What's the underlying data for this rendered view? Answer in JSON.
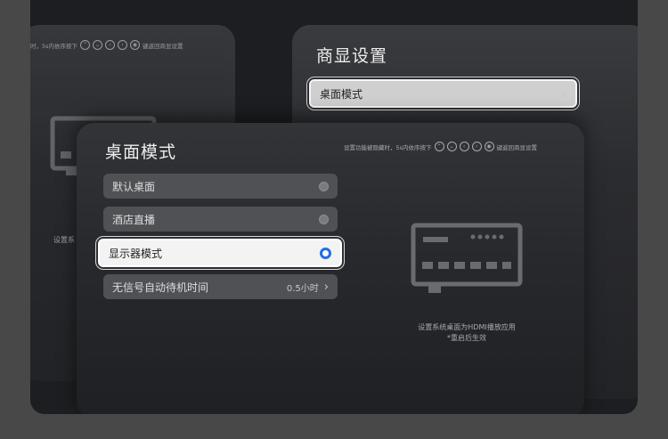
{
  "back_left": {
    "hint_text": "时，5s内依序按下",
    "hint_end": "键返回商显设置",
    "caption": "设置系"
  },
  "back_right": {
    "title": "商显设置",
    "focused_item": {
      "label": "桌面模式",
      "chevron": "›"
    }
  },
  "front": {
    "title": "桌面模式",
    "hint_text": "设置功能被隐藏时，5s内依序按下",
    "hint_end": "键返回商显设置",
    "items": [
      {
        "label": "默认桌面",
        "state": "off"
      },
      {
        "label": "酒店直播",
        "state": "off"
      },
      {
        "label": "显示器模式",
        "state": "on"
      },
      {
        "label": "无信号自动待机时间",
        "value": "0.5小时",
        "chevron": "›"
      }
    ],
    "caption_line1": "设置系统桌面为HDMI播放应用",
    "caption_line2": "*重启后生效"
  },
  "colors": {
    "accent": "#1f6fe5",
    "background": "#1d1e21"
  },
  "icons": [
    "up-icon",
    "down-icon",
    "left-icon",
    "right-icon",
    "ok-icon",
    "tv-display-icon"
  ]
}
